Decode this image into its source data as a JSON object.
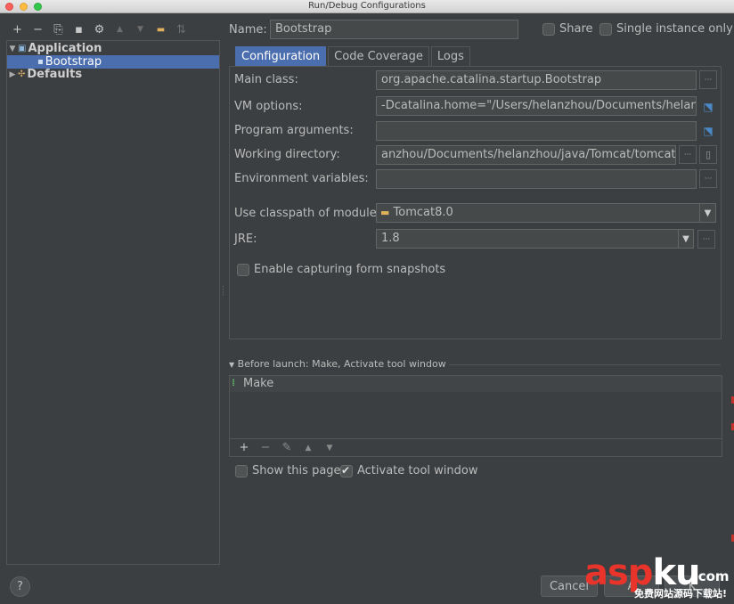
{
  "window": {
    "title": "Run/Debug Configurations"
  },
  "toolbar": {
    "buttons": [
      {
        "name": "add",
        "glyph": "+"
      },
      {
        "name": "remove",
        "glyph": "−"
      },
      {
        "name": "copy",
        "glyph": "⎘"
      },
      {
        "name": "save",
        "glyph": "▪"
      },
      {
        "name": "edit-defaults",
        "glyph": "⚙"
      },
      {
        "name": "move-up",
        "glyph": "▲"
      },
      {
        "name": "move-down",
        "glyph": "▼"
      },
      {
        "name": "folder",
        "glyph": "▬"
      },
      {
        "name": "sort",
        "glyph": "⇅"
      }
    ]
  },
  "tree": {
    "application": "Application",
    "bootstrap": "Bootstrap",
    "defaults": "Defaults"
  },
  "header": {
    "name_label": "Name:",
    "name_value": "Bootstrap",
    "share_label": "Share",
    "single_instance_label": "Single instance only"
  },
  "tabs": [
    "Configuration",
    "Code Coverage",
    "Logs"
  ],
  "config": {
    "main_class_label": "Main class:",
    "main_class_value": "org.apache.catalina.startup.Bootstrap",
    "vm_options_label": "VM options:",
    "vm_options_value": "-Dcatalina.home=\"/Users/helanzhou/Documents/helanzh",
    "program_args_label": "Program arguments:",
    "program_args_value": "",
    "working_dir_label": "Working directory:",
    "working_dir_value": "anzhou/Documents/helanzhou/java/Tomcat/tomcat8",
    "env_vars_label": "Environment variables:",
    "env_vars_value": "",
    "classpath_label": "Use classpath of module:",
    "classpath_value": "Tomcat8.0",
    "jre_label": "JRE:",
    "jre_value": "1.8",
    "snapshots_label": "Enable capturing form snapshots"
  },
  "before_launch": {
    "header": "Before launch: Make, Activate tool window",
    "items": [
      "Make"
    ],
    "toolbar": [
      "+",
      "−",
      "✎",
      "▲",
      "▼"
    ]
  },
  "footer": {
    "show_page_label": "Show this page",
    "activate_tool_label": "Activate tool window",
    "cancel_label": "Cancel",
    "apply_label": "A",
    "ok_label": "K",
    "help_label": "?"
  },
  "watermark": {
    "brand_red": "asp",
    "brand_white": "ku",
    "domain": ".com",
    "tagline": "免费网站源码下载站!"
  },
  "colors": {
    "background": "#3c3f41",
    "selection": "#4b6eaf",
    "field": "#45494a",
    "text": "#bbbbbb",
    "watermark_red": "#e8342a"
  }
}
